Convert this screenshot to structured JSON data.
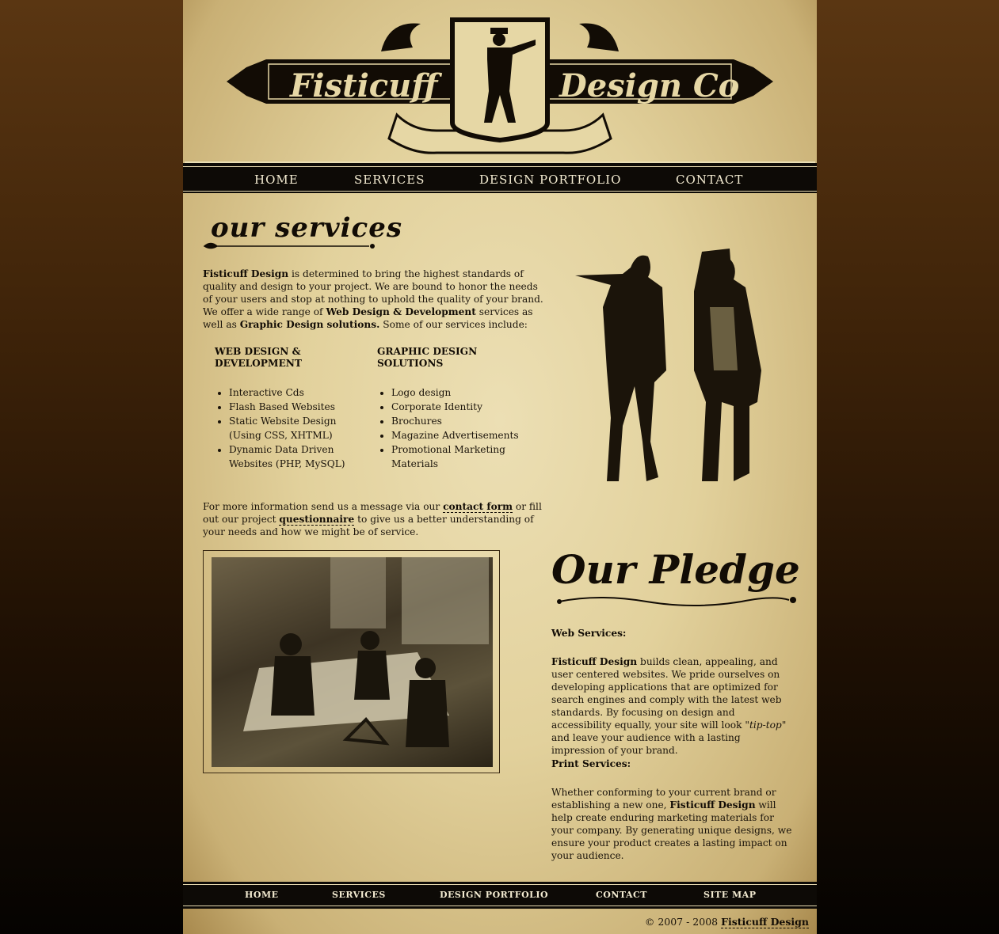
{
  "logo": {
    "left_text": "Fisticuff",
    "right_text": "Design Co"
  },
  "nav": {
    "items": [
      "HOME",
      "SERVICES",
      "DESIGN PORTFOLIO",
      "CONTACT"
    ]
  },
  "services": {
    "title": "our services",
    "intro": {
      "brand": "Fisticuff Design",
      "text1": " is determined to bring the highest standards of quality and design to your project. We are bound to honor the needs of your users and stop at nothing to uphold the quality of your brand. We offer a wide range of ",
      "web": "Web Design & Development",
      "text2": " services as well as ",
      "graphic": "Graphic Design solutions.",
      "text3": " Some of our services include:"
    },
    "web_heading": "WEB DESIGN & DEVELOPMENT",
    "web_items": [
      "Interactive Cds",
      "Flash Based Websites",
      "Static Website Design (Using CSS, XHTML)",
      "Dynamic Data Driven Websites (PHP, MySQL)"
    ],
    "graphic_heading": "GRAPHIC DESIGN SOLUTIONS",
    "graphic_items": [
      "Logo design",
      "Corporate Identity",
      "Brochures",
      "Magazine Advertisements",
      "Promotional Marketing Materials"
    ],
    "more": {
      "text1": "For more information send us a message via our ",
      "link1": "contact form",
      "text2": " or fill out our project ",
      "link2": "questionnaire",
      "text3": " to give us a better understanding of your needs and how we might be of service."
    }
  },
  "pledge": {
    "title": "Our Pledge",
    "web_label": "Web Services:",
    "web_brand": "Fisticuff Design",
    "web_text1": " builds clean, appealing, and user centered websites. We pride ourselves on developing applications that are optimized for search engines and comply with the latest web standards. By focusing on design and accessibility equally, your site will look ",
    "web_em": "\"tip-top\"",
    "web_text2": " and leave your audience with a lasting impression of your brand.",
    "print_label": "Print Services:",
    "print_text1": "Whether conforming to your current brand or establishing a new one, ",
    "print_brand": "Fisticuff Design",
    "print_text2": " will help create enduring marketing materials for your company. By generating unique designs, we ensure your product creates a lasting impact on your audience."
  },
  "footer": {
    "nav": [
      "HOME",
      "SERVICES",
      "DESIGN PORTFOLIO",
      "CONTACT",
      "SITE MAP"
    ],
    "copyright": "© 2007 - 2008 ",
    "brand": "Fisticuff Design"
  }
}
